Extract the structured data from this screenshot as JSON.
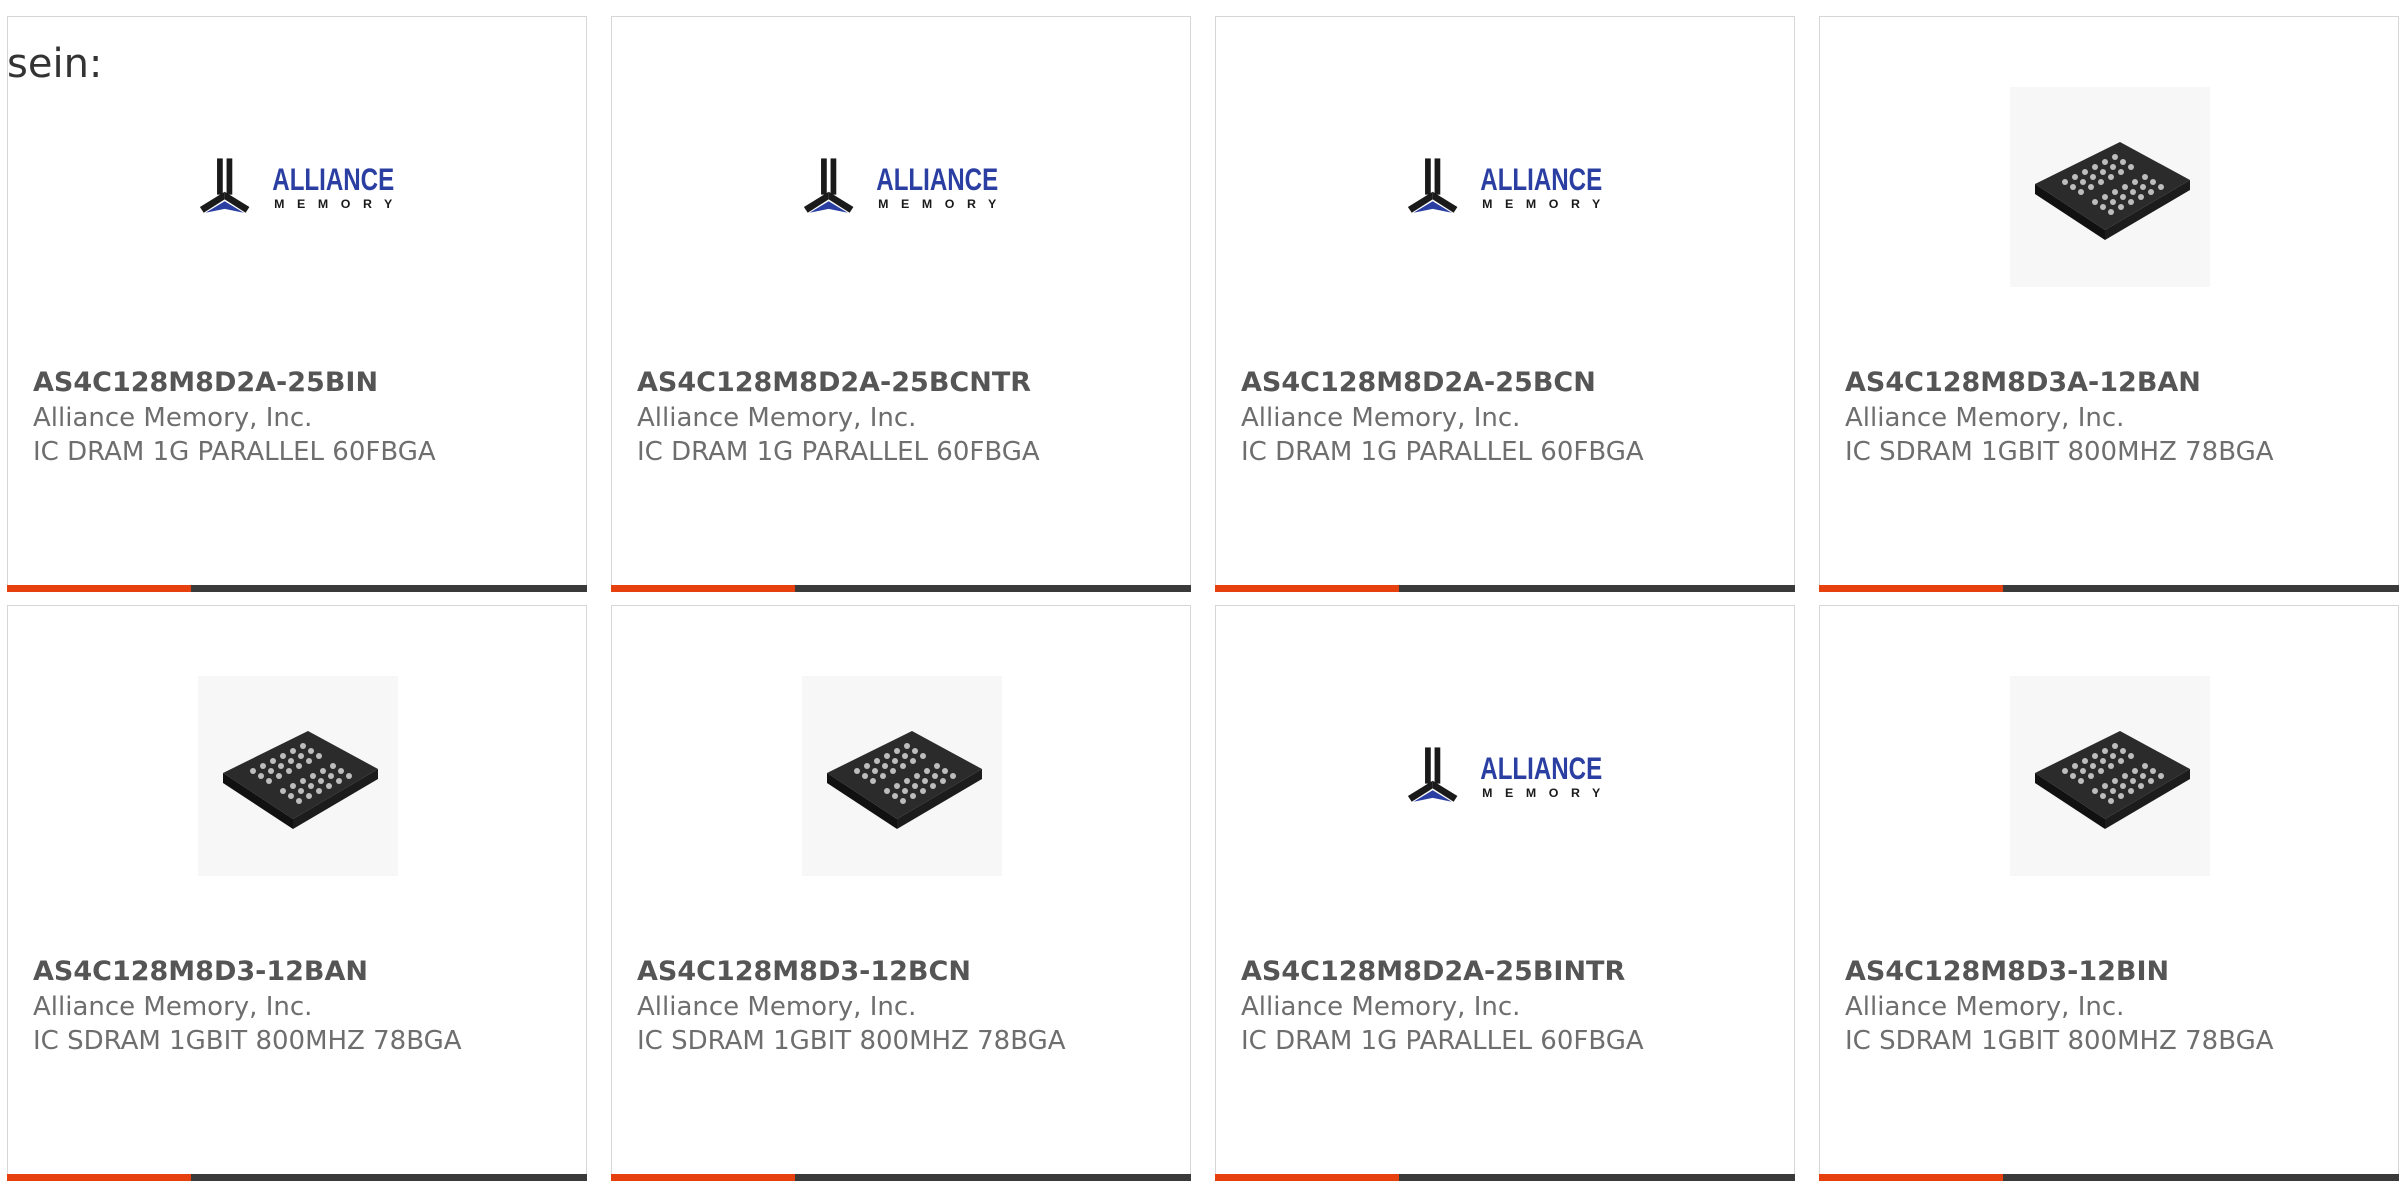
{
  "intro_text": "sein:",
  "colors": {
    "accent": "#e5400e",
    "bar_dark": "#3a3a3a",
    "logo_blue": "#2b3fa3",
    "logo_black": "#1a1a1a",
    "text_muted": "#6e6e6e",
    "text_title": "#555555",
    "border": "#d6d6d6"
  },
  "products": [
    {
      "part_number": "AS4C128M8D2A-25BIN",
      "manufacturer": "Alliance Memory, Inc.",
      "description": "IC DRAM 1G PARALLEL 60FBGA",
      "image": "alliance-memory-logo",
      "logo_text": "ALLIANCE",
      "logo_subtext": "MEMORY"
    },
    {
      "part_number": "AS4C128M8D2A-25BCNTR",
      "manufacturer": "Alliance Memory, Inc.",
      "description": "IC DRAM 1G PARALLEL 60FBGA",
      "image": "alliance-memory-logo",
      "logo_text": "ALLIANCE",
      "logo_subtext": "MEMORY"
    },
    {
      "part_number": "AS4C128M8D2A-25BCN",
      "manufacturer": "Alliance Memory, Inc.",
      "description": "IC DRAM 1G PARALLEL 60FBGA",
      "image": "alliance-memory-logo",
      "logo_text": "ALLIANCE",
      "logo_subtext": "MEMORY"
    },
    {
      "part_number": "AS4C128M8D3A-12BAN",
      "manufacturer": "Alliance Memory, Inc.",
      "description": "IC SDRAM 1GBIT 800MHZ 78BGA",
      "image": "bga-chip-photo"
    },
    {
      "part_number": "AS4C128M8D3-12BAN",
      "manufacturer": "Alliance Memory, Inc.",
      "description": "IC SDRAM 1GBIT 800MHZ 78BGA",
      "image": "bga-chip-photo"
    },
    {
      "part_number": "AS4C128M8D3-12BCN",
      "manufacturer": "Alliance Memory, Inc.",
      "description": "IC SDRAM 1GBIT 800MHZ 78BGA",
      "image": "bga-chip-photo"
    },
    {
      "part_number": "AS4C128M8D2A-25BINTR",
      "manufacturer": "Alliance Memory, Inc.",
      "description": "IC DRAM 1G PARALLEL 60FBGA",
      "image": "alliance-memory-logo",
      "logo_text": "ALLIANCE",
      "logo_subtext": "MEMORY"
    },
    {
      "part_number": "AS4C128M8D3-12BIN",
      "manufacturer": "Alliance Memory, Inc.",
      "description": "IC SDRAM 1GBIT 800MHZ 78BGA",
      "image": "bga-chip-photo"
    }
  ]
}
